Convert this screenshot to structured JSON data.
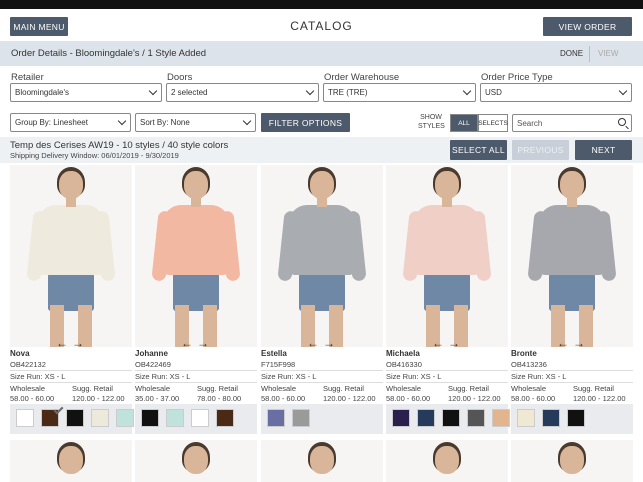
{
  "header": {
    "menu_label": "MAIN MENU",
    "title": "CATALOG",
    "view_order_label": "VIEW ORDER"
  },
  "order_bar": {
    "title": "Order Details - Bloomingdale's / 1 Style Added",
    "done_label": "DONE",
    "view_label": "VIEW"
  },
  "selectors": {
    "retailer": {
      "label": "Retailer",
      "value": "Bloomingdale's"
    },
    "doors": {
      "label": "Doors",
      "value": "2 selected"
    },
    "warehouse": {
      "label": "Order Warehouse",
      "value": "TRE (TRE)"
    },
    "price_type": {
      "label": "Order Price Type",
      "value": "USD"
    }
  },
  "filters": {
    "group_by": "Group By: Linesheet",
    "sort_by": "Sort By: None",
    "filter_options_label": "FILTER OPTIONS",
    "show_styles_label_1": "SHOW",
    "show_styles_label_2": "STYLES",
    "all_label": "ALL",
    "selects_label": "SELECTS",
    "search_placeholder": "Search"
  },
  "linesheet": {
    "title": "Temp des Cerises AW19 - 10 styles / 40 style colors",
    "window": "Shipping Delivery Window: 06/01/2019 - 9/30/2019",
    "select_all_label": "SELECT ALL",
    "previous_label": "PREVIOUS",
    "next_label": "NEXT"
  },
  "labels": {
    "wholesale": "Wholesale",
    "sugg_retail": "Sugg. Retail"
  },
  "products": [
    {
      "name": "Nova",
      "code": "OB422132",
      "size_run": "Size Run: XS - L",
      "wholesale": "58.00 - 60.00",
      "retail": "120.00 - 122.00",
      "garment_color": "#efeade",
      "swatches": [
        "#ffffff",
        "#4a2a17",
        "#111111",
        "#eeeadb",
        "#bfe3dc"
      ]
    },
    {
      "name": "Johanne",
      "code": "OB422469",
      "size_run": "Size Run: XS - L",
      "wholesale": "35.00 - 37.00",
      "retail": "78.00 - 80.00",
      "garment_color": "#f2b8a2",
      "swatches": [
        "#111111",
        "#bfe3dc",
        "#ffffff",
        "#4a2a17"
      ]
    },
    {
      "name": "Estella",
      "code": "F715F998",
      "size_run": "Size Run: XS - L",
      "wholesale": "58.00 - 60.00",
      "retail": "120.00 - 122.00",
      "garment_color": "#a9acb1",
      "swatches": [
        "#6a6fa3",
        "#9a9a9a"
      ]
    },
    {
      "name": "Michaela",
      "code": "OB416330",
      "size_run": "Size Run: XS - L",
      "wholesale": "58.00 - 60.00",
      "retail": "120.00 - 122.00",
      "garment_color": "#efcfc6",
      "swatches": [
        "#2b1f4d",
        "#263a5c",
        "#111111",
        "#555555",
        "#e2b48f"
      ]
    },
    {
      "name": "Bronte",
      "code": "OB413236",
      "size_run": "Size Run: XS - L",
      "wholesale": "58.00 - 60.00",
      "retail": "120.00 - 122.00",
      "garment_color": "#a7a8ad",
      "swatches": [
        "#efe8d2",
        "#263a5c",
        "#111111"
      ]
    }
  ]
}
